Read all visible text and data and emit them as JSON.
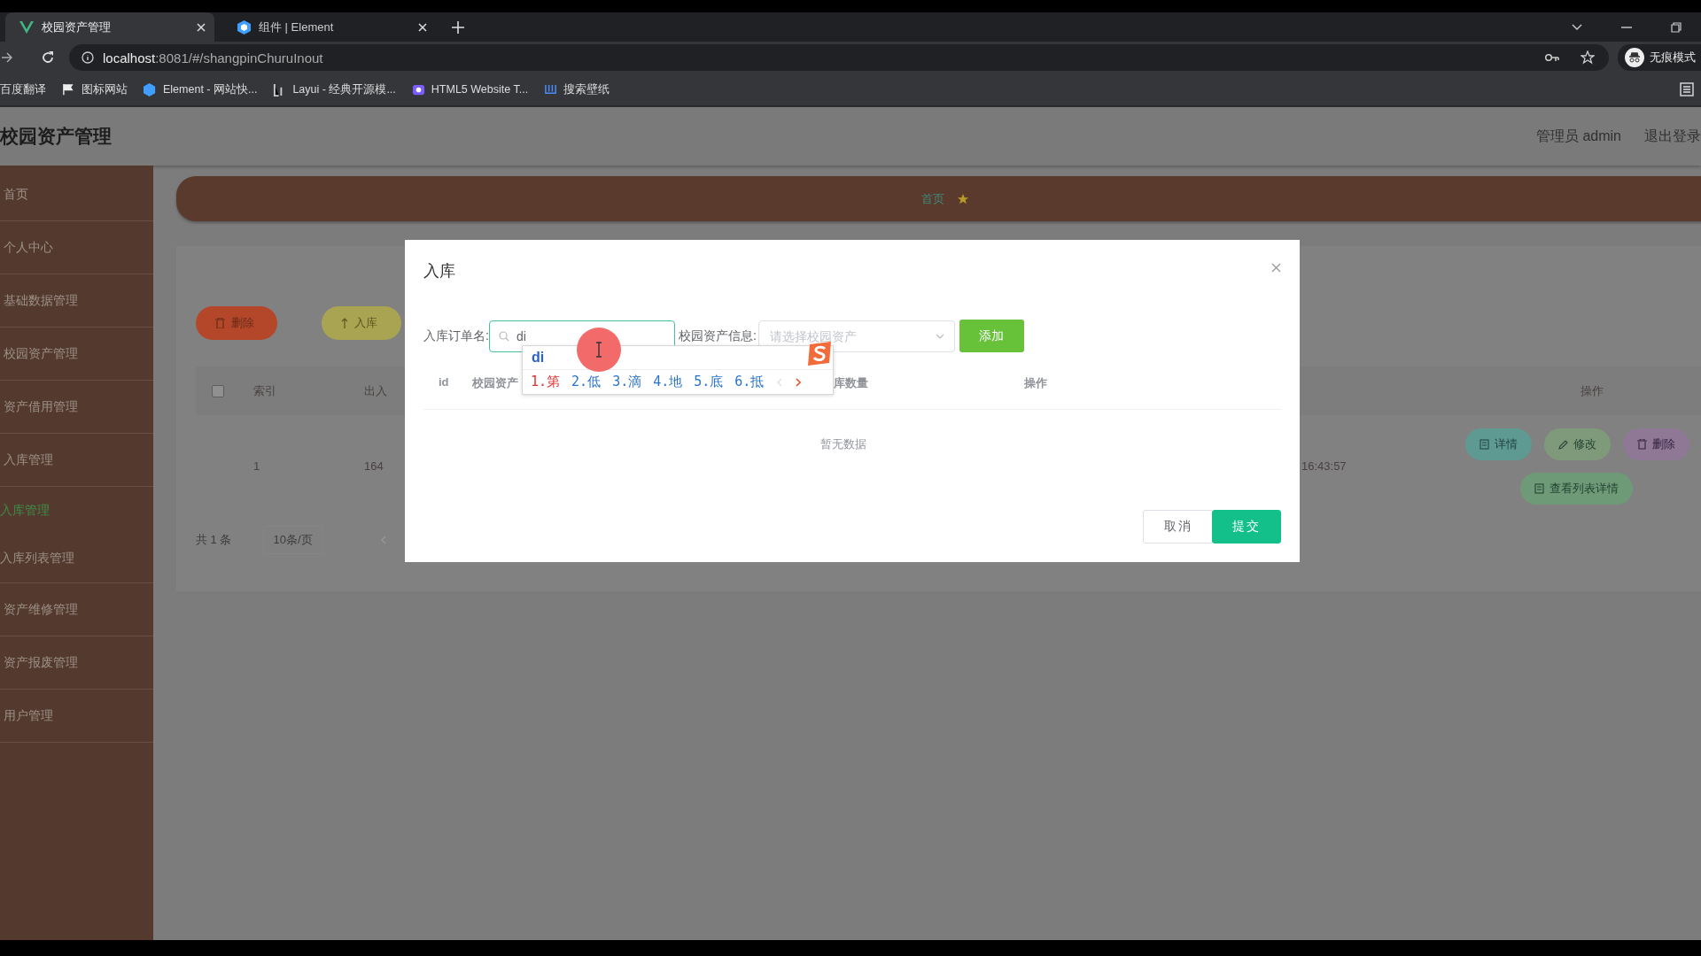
{
  "browser": {
    "tabs": [
      {
        "title": "校园资产管理",
        "selected": true
      },
      {
        "title": "组件 | Element",
        "selected": false
      }
    ],
    "address": {
      "host": "localhost",
      "path": ":8081/#/shangpinChuruInout"
    },
    "bookmarks": [
      "百度翻译",
      "图标网站",
      "Element - 网站快...",
      "Layui - 经典开源模...",
      "HTML5 Website T...",
      "搜索壁纸"
    ],
    "profile": "无痕模式"
  },
  "app": {
    "title": "校园资产管理",
    "user": "管理员 admin",
    "logout": "退出登录"
  },
  "sidebar": {
    "items": [
      {
        "label": "首页",
        "selected": false
      },
      {
        "label": "个人中心",
        "selected": false
      },
      {
        "label": "基础数据管理",
        "selected": false
      },
      {
        "label": "校园资产管理",
        "selected": false
      },
      {
        "label": "资产借用管理",
        "selected": false
      },
      {
        "label": "入库管理",
        "selected": false,
        "children": [
          {
            "label": "入库管理",
            "selected": true
          },
          {
            "label": "入库列表管理",
            "selected": false
          }
        ]
      },
      {
        "label": "资产维修管理",
        "selected": false
      },
      {
        "label": "资产报废管理",
        "selected": false
      },
      {
        "label": "用户管理",
        "selected": false
      }
    ]
  },
  "breadcrumb": [
    "首页"
  ],
  "toolbar": [
    {
      "label": "删除",
      "kind": "danger"
    },
    {
      "label": "入库",
      "kind": "warning"
    }
  ],
  "table": {
    "select_all": {
      "checked": false
    },
    "columns": [
      "索引",
      "出入",
      "操作"
    ],
    "rows": [
      {
        "cells": [
          "1",
          "164",
          "16:43:57"
        ],
        "actions": [
          {
            "label": "详情",
            "kind": "detail"
          },
          {
            "label": "修改",
            "kind": "edit"
          },
          {
            "label": "删除",
            "kind": "delete"
          },
          {
            "label": "查看列表详情",
            "kind": "list"
          }
        ]
      }
    ]
  },
  "pagination": {
    "total": "共 1 条",
    "page_size": "10条/页"
  },
  "dialog": {
    "title": "入库",
    "fields": [
      {
        "label": "入库订单名:",
        "kind": "search",
        "value": "di"
      },
      {
        "label": "校园资产信息:",
        "kind": "select",
        "placeholder": "请选择校园资产"
      }
    ],
    "add_button": "添加",
    "columns": [
      "id",
      "校园资产",
      "库数量",
      "操作"
    ],
    "empty_text": "暂无数据",
    "buttons": [
      {
        "label": "取消",
        "kind": "default"
      },
      {
        "label": "提交",
        "kind": "primary"
      }
    ]
  },
  "ime": {
    "composition": "di",
    "candidates": [
      {
        "text": "1.第",
        "selected": true
      },
      {
        "text": "2.低",
        "selected": false
      },
      {
        "text": "3.滴",
        "selected": false
      },
      {
        "text": "4.地",
        "selected": false
      },
      {
        "text": "5.底",
        "selected": false
      },
      {
        "text": "6.抵",
        "selected": false
      }
    ]
  }
}
